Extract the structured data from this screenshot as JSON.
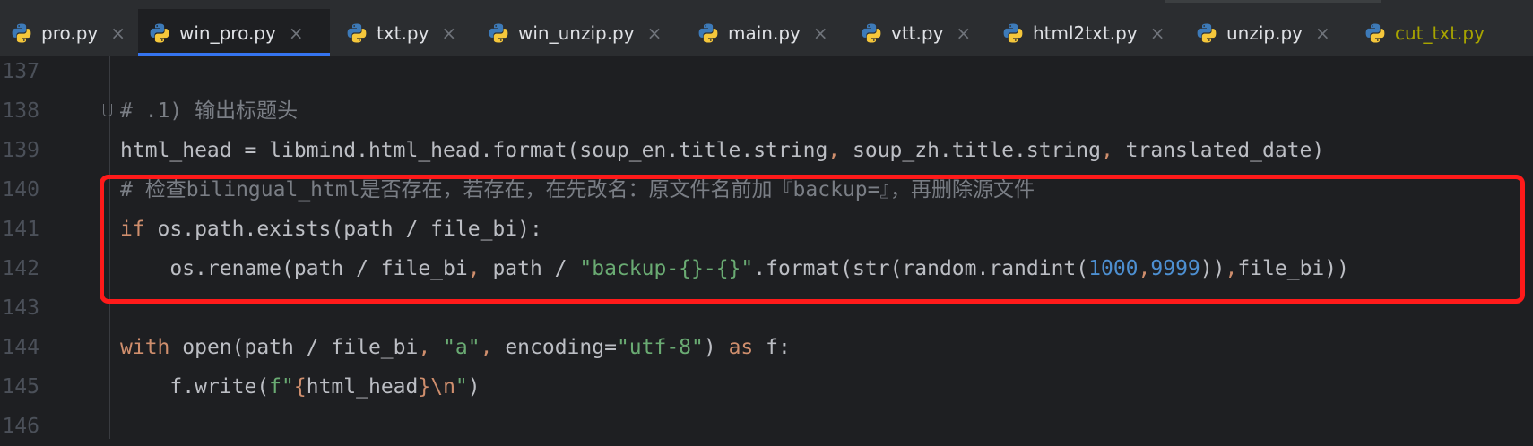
{
  "tabs": [
    {
      "label": "pro.py",
      "active": false,
      "modified": false
    },
    {
      "label": "win_pro.py",
      "active": true,
      "modified": false
    },
    {
      "label": "txt.py",
      "active": false,
      "modified": false
    },
    {
      "label": "win_unzip.py",
      "active": false,
      "modified": false
    },
    {
      "label": "main.py",
      "active": false,
      "modified": false
    },
    {
      "label": "vtt.py",
      "active": false,
      "modified": false
    },
    {
      "label": "html2txt.py",
      "active": false,
      "modified": false
    },
    {
      "label": "unzip.py",
      "active": false,
      "modified": false
    },
    {
      "label": "cut_txt.py",
      "active": false,
      "modified": true
    }
  ],
  "tab_close_glyph": "×",
  "tab_icon": "python-file-icon",
  "colors": {
    "accent": "#3574f0",
    "highlight_box": "#ff1a1a",
    "comment": "#7a7e85",
    "keyword": "#cf8e6d",
    "string": "#6aab73",
    "number": "#2aacb8"
  },
  "editor": {
    "lines": [
      {
        "number": "137",
        "segments": [
          {
            "cls": "c-txt",
            "text": ""
          }
        ]
      },
      {
        "number": "138",
        "segments": [
          {
            "cls": "c-com",
            "text": "# .1) 输出标题头"
          }
        ]
      },
      {
        "number": "139",
        "segments": [
          {
            "cls": "c-txt",
            "text": "html_head = libmind.html_head.format(soup_en.title.string"
          },
          {
            "cls": "c-kw",
            "text": ", "
          },
          {
            "cls": "c-txt",
            "text": "soup_zh.title.string"
          },
          {
            "cls": "c-kw",
            "text": ", "
          },
          {
            "cls": "c-txt",
            "text": "translated_date)"
          }
        ]
      },
      {
        "number": "140",
        "segments": [
          {
            "cls": "c-com",
            "text": "# 检查bilingual_html是否存在，若存在，在先改名：原文件名前加『backup=』，再删除源文件"
          }
        ]
      },
      {
        "number": "141",
        "segments": [
          {
            "cls": "c-kw",
            "text": "if "
          },
          {
            "cls": "c-txt",
            "text": "os.path.exists(path / file_bi):"
          }
        ]
      },
      {
        "number": "142",
        "segments": [
          {
            "cls": "c-txt",
            "text": "    os.rename(path / file_bi"
          },
          {
            "cls": "c-kw",
            "text": ", "
          },
          {
            "cls": "c-txt",
            "text": "path / "
          },
          {
            "cls": "c-str",
            "text": "\"backup-{}-{}\""
          },
          {
            "cls": "c-txt",
            "text": ".format(str(random.randint("
          },
          {
            "cls": "c-num2",
            "text": "1000"
          },
          {
            "cls": "c-kw",
            "text": ","
          },
          {
            "cls": "c-num2",
            "text": "9999"
          },
          {
            "cls": "c-txt",
            "text": "))"
          },
          {
            "cls": "c-kw",
            "text": ","
          },
          {
            "cls": "c-txt",
            "text": "file_bi))"
          }
        ]
      },
      {
        "number": "143",
        "segments": [
          {
            "cls": "c-txt",
            "text": ""
          }
        ]
      },
      {
        "number": "144",
        "segments": [
          {
            "cls": "c-kw",
            "text": "with "
          },
          {
            "cls": "c-txt",
            "text": "open(path / file_bi"
          },
          {
            "cls": "c-kw",
            "text": ", "
          },
          {
            "cls": "c-str",
            "text": "\"a\""
          },
          {
            "cls": "c-kw",
            "text": ", "
          },
          {
            "cls": "c-txt",
            "text": "encoding="
          },
          {
            "cls": "c-str",
            "text": "\"utf-8\""
          },
          {
            "cls": "c-txt",
            "text": ") "
          },
          {
            "cls": "c-kw",
            "text": "as "
          },
          {
            "cls": "c-txt",
            "text": "f:"
          }
        ]
      },
      {
        "number": "145",
        "segments": [
          {
            "cls": "c-txt",
            "text": "    f.write("
          },
          {
            "cls": "c-str",
            "text": "f\""
          },
          {
            "cls": "c-kw",
            "text": "{"
          },
          {
            "cls": "c-txt",
            "text": "html_head"
          },
          {
            "cls": "c-kw",
            "text": "}"
          },
          {
            "cls": "c-kw",
            "text": "\\n"
          },
          {
            "cls": "c-str",
            "text": "\""
          },
          {
            "cls": "c-txt",
            "text": ")"
          }
        ]
      },
      {
        "number": "146",
        "segments": [
          {
            "cls": "c-txt",
            "text": ""
          }
        ]
      }
    ]
  }
}
